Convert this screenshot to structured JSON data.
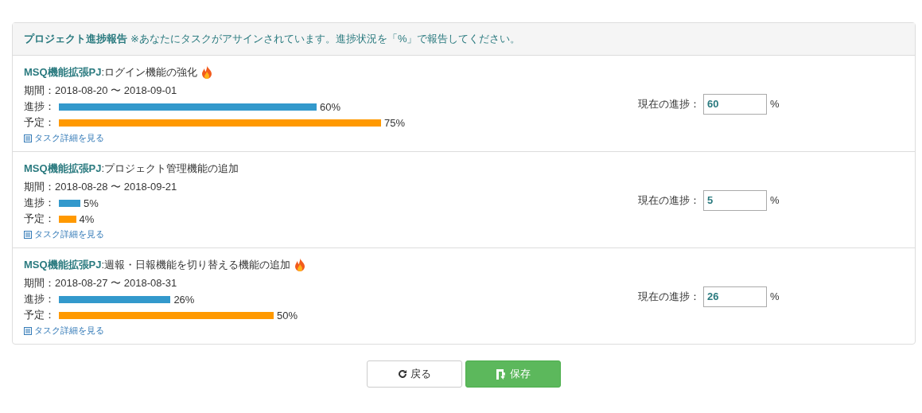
{
  "panel": {
    "title": "プロジェクト進捗報告",
    "note": "※あなたにタスクがアサインされています。進捗状況を「%」で報告してください。"
  },
  "tasks": [
    {
      "project": "MSQ機能拡張PJ",
      "name": ":ログイン機能の強化",
      "hot": true,
      "period": "期間：2018-08-20 〜 2018-09-01",
      "progress_label": "進捗：",
      "progress": {
        "reading": "60%"
      },
      "plan_label": "予定：",
      "plan": {
        "reading": "75%"
      },
      "detail_link": "タスク詳細を見る",
      "current_label": "現在の進捗：",
      "current_value": "60",
      "unit": "%"
    },
    {
      "project": "MSQ機能拡張PJ",
      "name": ":プロジェクト管理機能の追加",
      "hot": false,
      "period": "期間：2018-08-28 〜 2018-09-21",
      "progress_label": "進捗：",
      "progress": {
        "reading": "5%"
      },
      "plan_label": "予定：",
      "plan": {
        "reading": "4%"
      },
      "detail_link": "タスク詳細を見る",
      "current_label": "現在の進捗：",
      "current_value": "5",
      "unit": "%"
    },
    {
      "project": "MSQ機能拡張PJ",
      "name": ":週報・日報機能を切り替える機能の追加",
      "hot": true,
      "period": "期間：2018-08-27 〜 2018-08-31",
      "progress_label": "進捗：",
      "progress": {
        "reading": "26%"
      },
      "plan_label": "予定：",
      "plan": {
        "reading": "50%"
      },
      "detail_link": "タスク詳細を見る",
      "current_label": "現在の進捗：",
      "current_value": "26",
      "unit": "%"
    }
  ],
  "buttons": [
    {
      "kind": "back",
      "label": "戻る"
    },
    {
      "kind": "save",
      "label": "保存"
    }
  ]
}
